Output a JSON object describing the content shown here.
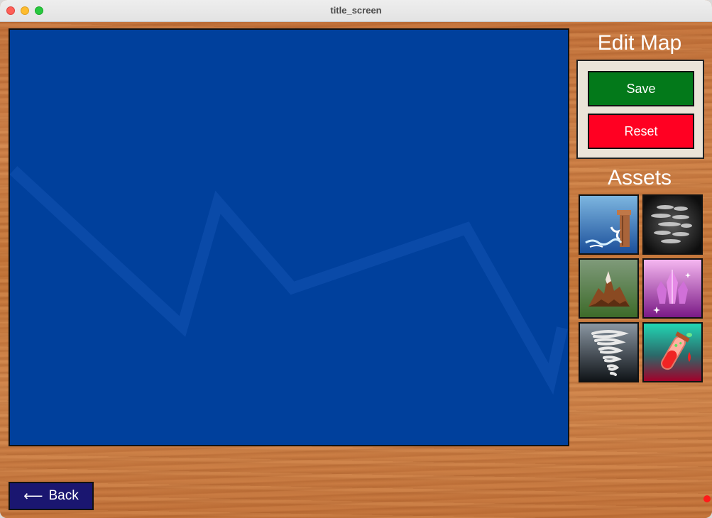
{
  "window": {
    "title": "title_screen"
  },
  "sidebar": {
    "edit_heading": "Edit Map",
    "save_label": "Save",
    "reset_label": "Reset",
    "assets_heading": "Assets"
  },
  "assets": [
    {
      "icon": "waterfall-icon"
    },
    {
      "icon": "fog-icon"
    },
    {
      "icon": "mountain-icon"
    },
    {
      "icon": "crystal-icon"
    },
    {
      "icon": "tornado-icon"
    },
    {
      "icon": "potion-icon"
    }
  ],
  "footer": {
    "back_arrow": "⟵",
    "back_label": "Back"
  },
  "colors": {
    "map_background": "#00409c",
    "save_button": "#03791a",
    "reset_button": "#ff0022",
    "back_button": "#1a1670"
  }
}
